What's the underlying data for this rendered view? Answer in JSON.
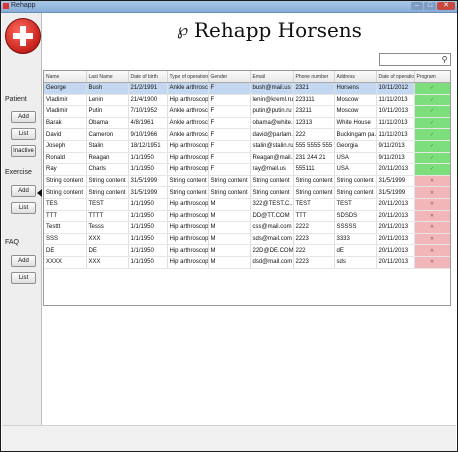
{
  "window": {
    "title": "Rehapp"
  },
  "app": {
    "title": "Rehapp Horsens"
  },
  "sidebar": {
    "sections": [
      {
        "label": "Patient",
        "buttons": [
          "Add",
          "List",
          "Inactive"
        ]
      },
      {
        "label": "Exercise",
        "buttons": [
          "Add",
          "List"
        ]
      },
      {
        "label": "FAQ",
        "buttons": [
          "Add",
          "List"
        ]
      }
    ]
  },
  "search": {
    "value": ""
  },
  "table": {
    "columns": [
      "Name",
      "Last Name",
      "Date of birth",
      "Type of operation",
      "Gender",
      "Email",
      "Phone number",
      "Address",
      "Date of operation",
      "Program"
    ],
    "rows": [
      {
        "cells": [
          "George",
          "Bush",
          "21/2/1991",
          "Ankle arthrosc...",
          "F",
          "bush@mail.us",
          "2321",
          "Horsens",
          "10/11/2012",
          "✓"
        ],
        "program": "green",
        "selected": true
      },
      {
        "cells": [
          "Vladimir",
          "Lenin",
          "21/4/1900",
          "Hip arthroscopy",
          "F",
          "lenin@kreml.ru",
          "223111",
          "Moscow",
          "11/11/2013",
          "✓"
        ],
        "program": "green"
      },
      {
        "cells": [
          "Vladimir",
          "Putin",
          "7/10/1952",
          "Ankle arthrosc...",
          "F",
          "putin@putin.ru",
          "23211",
          "Moscow",
          "10/11/2013",
          "✓"
        ],
        "program": "green"
      },
      {
        "cells": [
          "Barak",
          "Obama",
          "4/8/1961",
          "Ankle arthrosc...",
          "F",
          "obama@white...",
          "12313",
          "White House",
          "11/11/2013",
          "✓"
        ],
        "program": "green"
      },
      {
        "cells": [
          "David",
          "Cameron",
          "9/10/1966",
          "Ankle arthrosc...",
          "F",
          "david@parlam...",
          "222",
          "Buckingam pa...",
          "11/11/2013",
          "✓"
        ],
        "program": "green"
      },
      {
        "cells": [
          "Joseph",
          "Stalin",
          "18/12/1951",
          "Hip arthroscopy",
          "F",
          "stalin@stalin.ru",
          "555 5555 555",
          "Georgia",
          "9/11/2013",
          "✓"
        ],
        "program": "green"
      },
      {
        "cells": [
          "Ronald",
          "Reagan",
          "1/1/1950",
          "Hip arthroscopy",
          "F",
          "Reagan@mail....",
          "231 244 21",
          "USA",
          "9/11/2013",
          "✓"
        ],
        "program": "green"
      },
      {
        "cells": [
          "Ray",
          "Charls",
          "1/1/1950",
          "Hip arthroscopy",
          "F",
          "ray@mail.us",
          "555111",
          "USA",
          "20/11/2013",
          "✓"
        ],
        "program": "green"
      },
      {
        "cells": [
          "String content",
          "String content",
          "31/5/1999",
          "String content",
          "String content",
          "String content",
          "String content",
          "String content",
          "31/5/1999",
          "✕"
        ],
        "program": "red"
      },
      {
        "cells": [
          "String content",
          "String content",
          "31/5/1999",
          "String content",
          "String content",
          "String content",
          "String content",
          "String content",
          "31/5/1999",
          "✕"
        ],
        "program": "red"
      },
      {
        "cells": [
          "TES",
          "TEST",
          "1/1/1950",
          "Hip arthroscopy",
          "M",
          "322@TEST.C...",
          "TEST",
          "TEST",
          "20/11/2013",
          "✕"
        ],
        "program": "red"
      },
      {
        "cells": [
          "TTT",
          "TTTT",
          "1/1/1950",
          "Hip arthroscopy",
          "M",
          "DD@TT.COM",
          "TTT",
          "SDSDS",
          "20/11/2013",
          "✕"
        ],
        "program": "red"
      },
      {
        "cells": [
          "Testtt",
          "Tesss",
          "1/1/1950",
          "Hip arthroscopy",
          "M",
          "css@mail.com",
          "2222",
          "SSSSS",
          "20/11/2013",
          "✕"
        ],
        "program": "red"
      },
      {
        "cells": [
          "SSS",
          "XXX",
          "1/1/1950",
          "Hip arthroscopy",
          "M",
          "sds@mail.com",
          "2223",
          "3333",
          "20/11/2013",
          "✕"
        ],
        "program": "red"
      },
      {
        "cells": [
          "DE",
          "DE",
          "1/1/1950",
          "Hip arthroscopy",
          "M",
          "22D@DE.COM",
          "222",
          "dE",
          "20/11/2013",
          "✕"
        ],
        "program": "red"
      },
      {
        "cells": [
          "XXXX",
          "XXX",
          "1/1/1950",
          "Hip arthroscopy",
          "M",
          "dsd@mail.com",
          "2223",
          "sds",
          "20/11/2013",
          "✕"
        ],
        "program": "red"
      }
    ]
  },
  "icons": {
    "logo": "hospital-cross-icon",
    "header": "stethoscope-icon",
    "search": "search-icon"
  },
  "colors": {
    "selected_row": "#c3d8f0",
    "program_active": "#7ddf7c",
    "program_inactive": "#f2b6b9",
    "logo_red": "#c6221b"
  }
}
